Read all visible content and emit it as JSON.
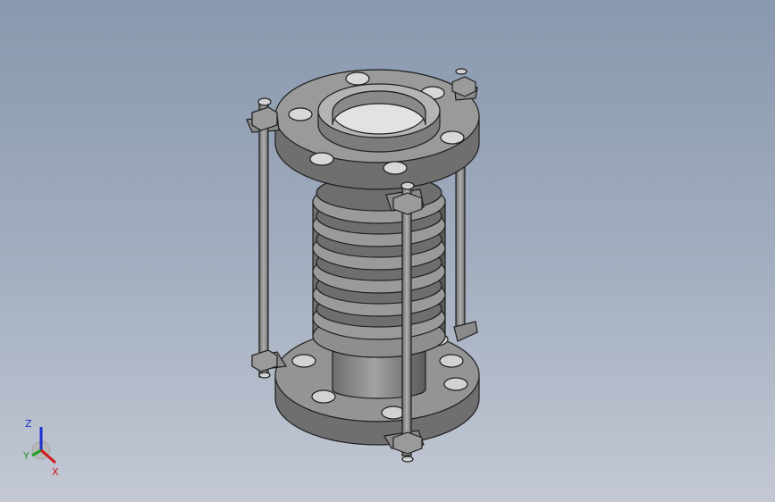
{
  "viewport": {
    "model": "expansion-joint-bellows",
    "background_top": "#8898ae",
    "background_bottom": "#c3c8d4",
    "part_color": "#8a8a8a"
  },
  "triad": {
    "z_label": "Z",
    "y_label": "Y",
    "x_label": "X",
    "z_color": "#1a2fd0",
    "y_color": "#1aa01a",
    "x_color": "#d01a1a"
  }
}
